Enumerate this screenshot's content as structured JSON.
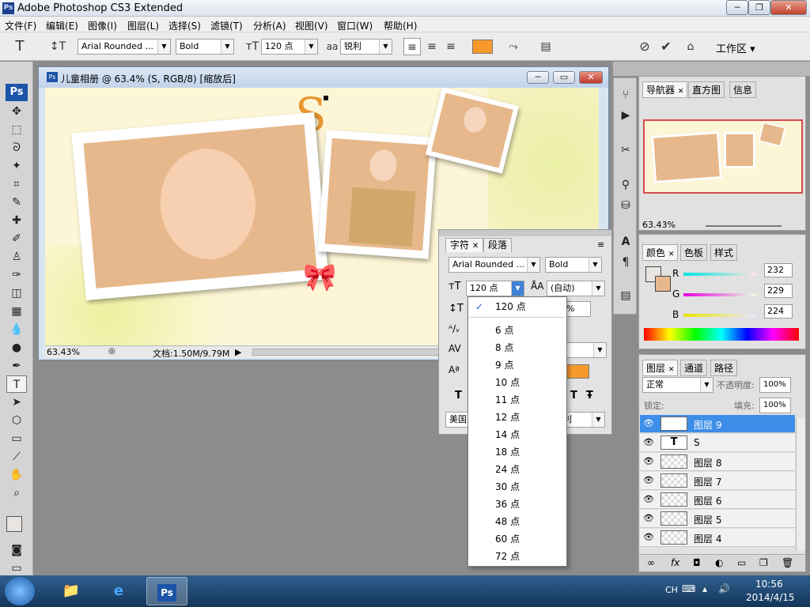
{
  "app": {
    "title": "Adobe Photoshop CS3 Extended",
    "logo": "Ps"
  },
  "menu": [
    "文件(F)",
    "编辑(E)",
    "图像(I)",
    "图层(L)",
    "选择(S)",
    "滤镜(T)",
    "分析(A)",
    "视图(V)",
    "窗口(W)",
    "帮助(H)"
  ],
  "options": {
    "font_family": "Arial Rounded ...",
    "font_style": "Bold",
    "font_size": "120 点",
    "antialias": "锐利",
    "color": "#f79a2b",
    "workspace": "工作区 ▾"
  },
  "document": {
    "title": "儿童相册 @ 63.4% (S, RGB/8) [缩放后]",
    "zoom": "63.43%",
    "doc_info": "文档:1.50M/9.79M",
    "canvas_letter": "S"
  },
  "char_panel": {
    "tabs": [
      "字符",
      "段落"
    ],
    "font_family": "Arial Rounded ...",
    "font_style": "Bold",
    "font_size": "120 点",
    "leading": "(自动)",
    "percent": "%",
    "language": "美国",
    "antialias_short": "利",
    "t_buttons": [
      "T",
      "T",
      "T",
      "Ŧ"
    ]
  },
  "size_dropdown": {
    "current": "120 点",
    "items": [
      "6 点",
      "8 点",
      "9 点",
      "10 点",
      "11 点",
      "12 点",
      "14 点",
      "18 点",
      "24 点",
      "30 点",
      "36 点",
      "48 点",
      "60 点",
      "72 点"
    ]
  },
  "navigator": {
    "tabs": [
      "导航器",
      "直方图",
      "信息"
    ],
    "zoom": "63.43%"
  },
  "color_panel": {
    "tabs": [
      "颜色",
      "色板",
      "样式"
    ],
    "r_label": "R",
    "r": "232",
    "g_label": "G",
    "g": "229",
    "b_label": "B",
    "b": "224",
    "fg": "#e8e5e0",
    "bg": "#e6b88c"
  },
  "layers_panel": {
    "tabs": [
      "图层",
      "通道",
      "路径"
    ],
    "blend": "正常",
    "opacity_label": "不透明度:",
    "opacity": "100%",
    "lock_label": "锁定:",
    "fill_label": "填充:",
    "fill": "100%",
    "layers": [
      {
        "name": "图层 9",
        "type": "text",
        "selected": true
      },
      {
        "name": "S",
        "type": "text",
        "selected": false
      },
      {
        "name": "图层 8",
        "type": "raster",
        "selected": false
      },
      {
        "name": "图层 7",
        "type": "raster",
        "selected": false
      },
      {
        "name": "图层 6",
        "type": "raster",
        "selected": false
      },
      {
        "name": "图层 5",
        "type": "raster",
        "selected": false
      },
      {
        "name": "图层 4",
        "type": "raster",
        "selected": false
      }
    ]
  },
  "taskbar": {
    "lang": "CH",
    "time": "10:56",
    "date": "2014/4/15"
  }
}
